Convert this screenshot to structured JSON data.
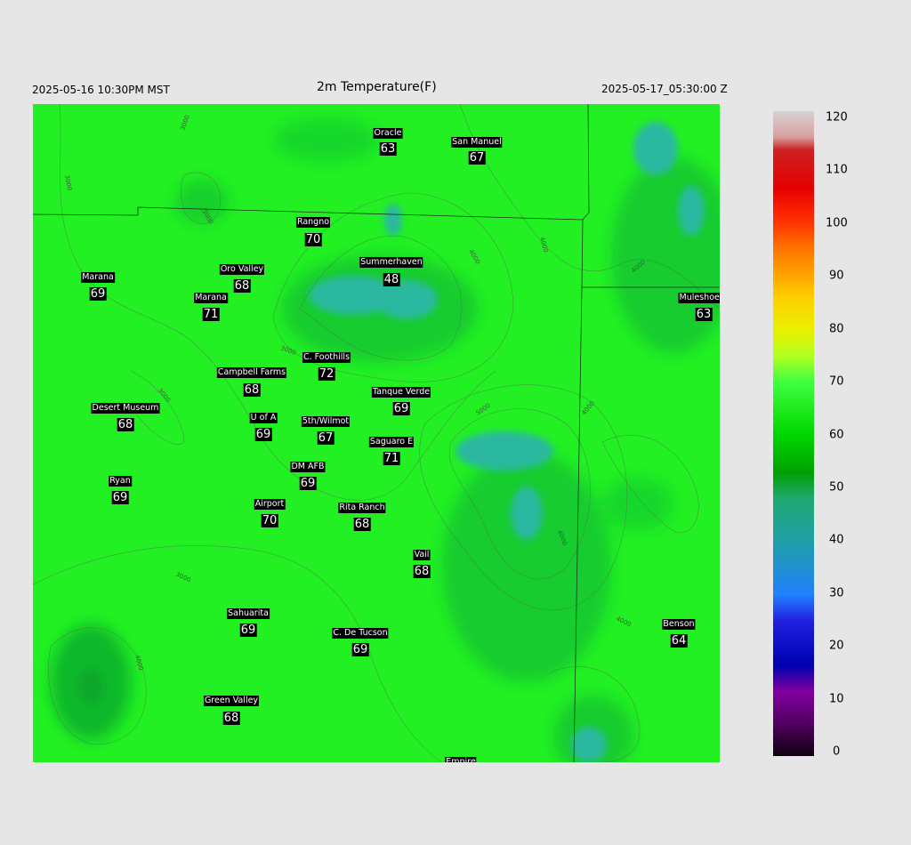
{
  "header": {
    "valid_local": "2025-05-16 10:30PM MST",
    "title": "2m Temperature(F)",
    "valid_utc": "2025-05-17_05:30:00 Z"
  },
  "colorbar": {
    "ticks": [
      "120",
      "110",
      "100",
      "90",
      "80",
      "70",
      "60",
      "50",
      "40",
      "30",
      "20",
      "10",
      "0"
    ]
  },
  "stations": [
    {
      "id": "oracle",
      "name": "Oracle",
      "value": "63"
    },
    {
      "id": "san-manuel",
      "name": "San Manuel",
      "value": "67"
    },
    {
      "id": "rangno",
      "name": "Rangno",
      "value": "70"
    },
    {
      "id": "marana-w",
      "name": "Marana",
      "value": "69"
    },
    {
      "id": "oro-valley",
      "name": "Oro Valley",
      "value": "68"
    },
    {
      "id": "summerhaven",
      "name": "Summerhaven",
      "value": "48"
    },
    {
      "id": "marana",
      "name": "Marana",
      "value": "71"
    },
    {
      "id": "muleshoe-r",
      "name": "Muleshoe R",
      "value": "63"
    },
    {
      "id": "c-foothills",
      "name": "C. Foothills",
      "value": "72"
    },
    {
      "id": "campbell-farms",
      "name": "Campbell Farms",
      "value": "68"
    },
    {
      "id": "tanque-verde",
      "name": "Tanque Verde",
      "value": "69"
    },
    {
      "id": "desert-museum",
      "name": "Desert Museum",
      "value": "68"
    },
    {
      "id": "u-of-a",
      "name": "U of A",
      "value": "69"
    },
    {
      "id": "5th-wilmot",
      "name": "5th/Wilmot",
      "value": "67"
    },
    {
      "id": "saguaro-e",
      "name": "Saguaro E",
      "value": "71"
    },
    {
      "id": "dm-afb",
      "name": "DM AFB",
      "value": "69"
    },
    {
      "id": "ryan",
      "name": "Ryan",
      "value": "69"
    },
    {
      "id": "airport",
      "name": "Airport",
      "value": "70"
    },
    {
      "id": "rita-ranch",
      "name": "Rita Ranch",
      "value": "68"
    },
    {
      "id": "vail",
      "name": "Vail",
      "value": "68"
    },
    {
      "id": "sahuarita",
      "name": "Sahuarita",
      "value": "69"
    },
    {
      "id": "c-de-tucson",
      "name": "C. De Tucson",
      "value": "69"
    },
    {
      "id": "benson",
      "name": "Benson",
      "value": "64"
    },
    {
      "id": "green-valley",
      "name": "Green Valley",
      "value": "68"
    },
    {
      "id": "empire",
      "name": "Empire",
      "value": ""
    }
  ],
  "contour_labels": [
    "3000",
    "3000",
    "3000",
    "3000",
    "3000",
    "3000",
    "4000",
    "4000",
    "4000",
    "4000",
    "4000",
    "4000",
    "4000",
    "5000"
  ]
}
